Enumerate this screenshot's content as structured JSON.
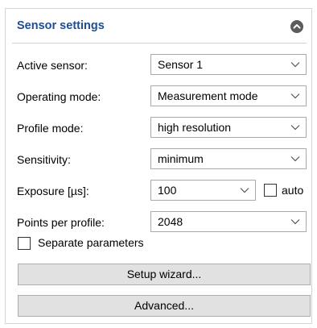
{
  "panel": {
    "title": "Sensor settings"
  },
  "fields": {
    "active_sensor": {
      "label": "Active sensor:",
      "value": "Sensor 1"
    },
    "operating_mode": {
      "label": "Operating mode:",
      "value": "Measurement mode"
    },
    "profile_mode": {
      "label": "Profile mode:",
      "value": "high resolution"
    },
    "sensitivity": {
      "label": "Sensitivity:",
      "value": "minimum"
    },
    "exposure": {
      "label": "Exposure [µs]:",
      "value": "100",
      "auto_label": "auto",
      "auto_checked": false
    },
    "points_per_profile": {
      "label": "Points per profile:",
      "value": "2048"
    }
  },
  "separate_parameters": {
    "label": "Separate parameters",
    "checked": false
  },
  "buttons": {
    "setup_wizard": "Setup wizard...",
    "advanced": "Advanced..."
  },
  "icons": {
    "collapse": "chevron-up-circle-icon",
    "dropdown": "chevron-down-icon"
  },
  "colors": {
    "title": "#1c4e91",
    "button_bg": "#e1e1e1",
    "border": "#a9a9a9"
  }
}
